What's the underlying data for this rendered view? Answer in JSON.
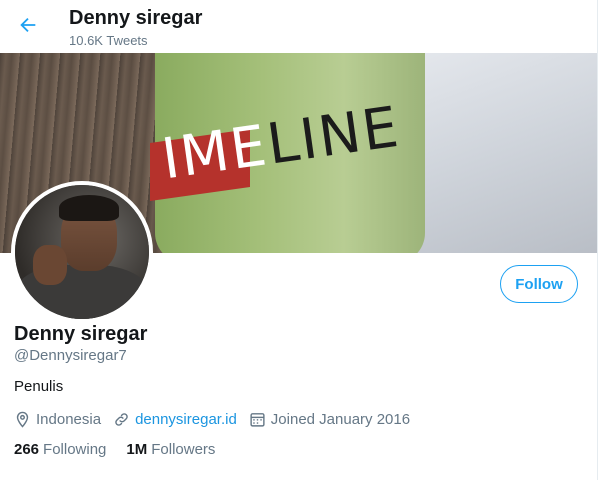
{
  "header": {
    "title": "Denny siregar",
    "tweet_count": "10.6K Tweets"
  },
  "banner": {
    "logo_prefix": "IME",
    "logo_suffix": "LINE"
  },
  "profile": {
    "name": "Denny siregar",
    "handle": "@Dennysiregar7",
    "bio": "Penulis",
    "location": "Indonesia",
    "website": "dennysiregar.id",
    "joined": "Joined January 2016",
    "follow_label": "Follow"
  },
  "stats": {
    "following_count": "266",
    "following_label": "Following",
    "followers_count": "1M",
    "followers_label": "Followers"
  },
  "colors": {
    "accent": "#1da1f2",
    "secondary_text": "#657786"
  },
  "icons": [
    "back-arrow-icon",
    "location-icon",
    "link-icon",
    "calendar-icon"
  ]
}
